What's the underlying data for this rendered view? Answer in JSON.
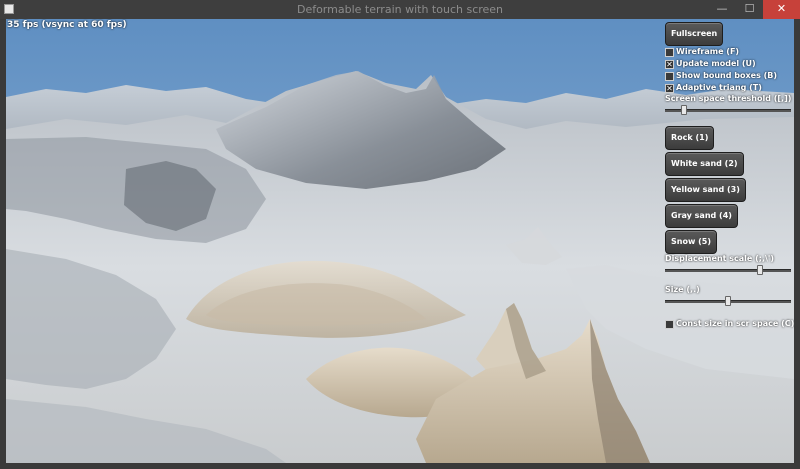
{
  "window": {
    "title": "Deformable terrain with touch screen",
    "minimize": "—",
    "maximize": "☐",
    "close": "✕"
  },
  "overlay": {
    "fps_text": "35 fps (vsync at 60 fps)"
  },
  "panel": {
    "fullscreen_label": "Fullscreen",
    "checkboxes": [
      {
        "label": "Wireframe (F)",
        "checked": false
      },
      {
        "label": "Update model (U)",
        "checked": true
      },
      {
        "label": "Show bound boxes (B)",
        "checked": false
      },
      {
        "label": "Adaptive triang (T)",
        "checked": true
      }
    ],
    "threshold_label": "Screen space threshold ([,])",
    "threshold_value": 0.15,
    "materials": [
      {
        "label": "Rock (1)"
      },
      {
        "label": "White sand (2)"
      },
      {
        "label": "Yellow sand (3)"
      },
      {
        "label": "Gray sand (4)"
      },
      {
        "label": "Snow (5)"
      }
    ],
    "displacement_label": "Displacement scale (;,\\')",
    "displacement_value": 0.75,
    "size_label": "Size (,.)",
    "size_value": 0.5,
    "const_size": {
      "label": "Const size in scr space (C)",
      "checked": false
    }
  },
  "colors": {
    "sky": "#6f9ac7",
    "close_button": "#c7413a"
  }
}
